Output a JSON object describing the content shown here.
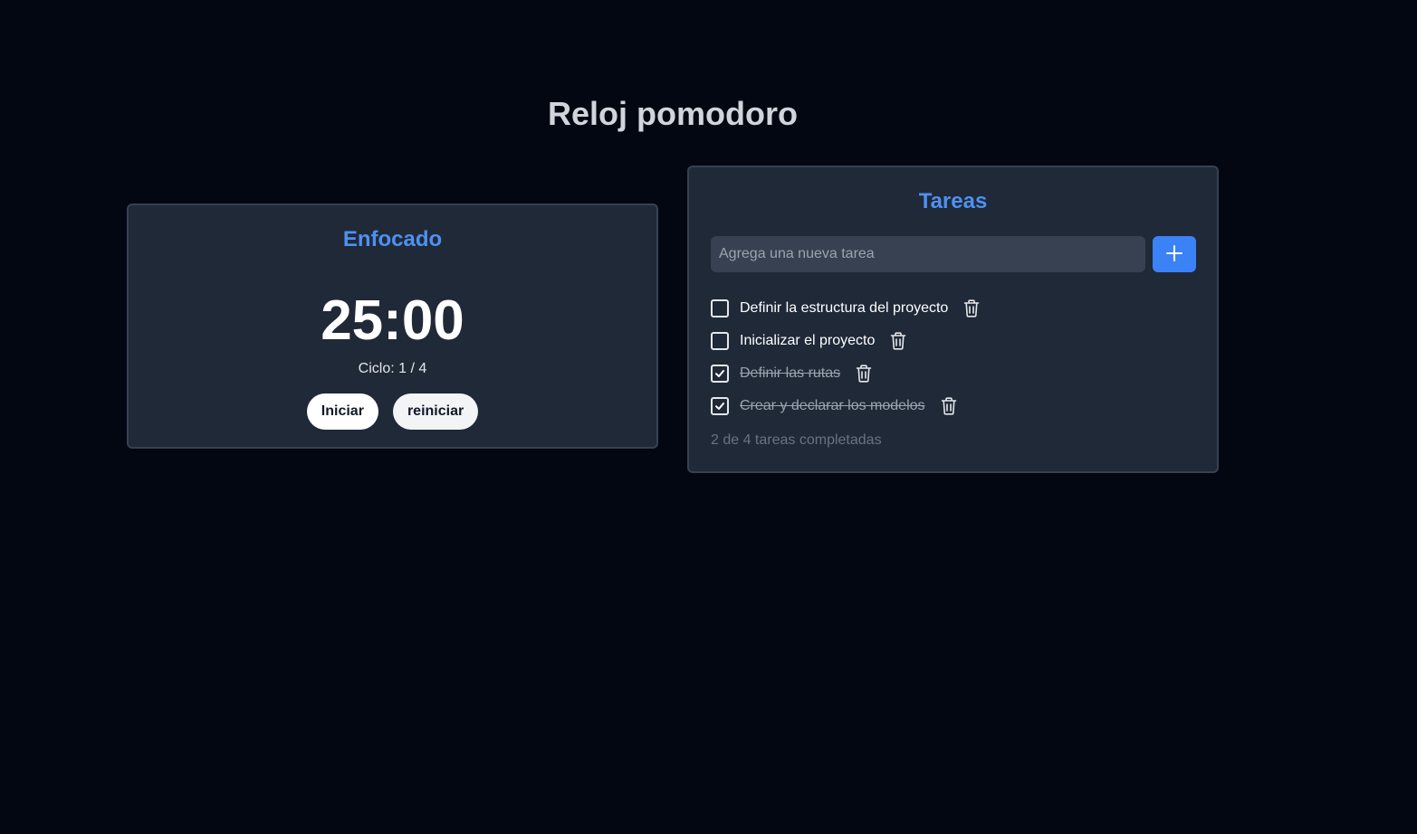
{
  "page": {
    "title": "Reloj pomodoro"
  },
  "timer": {
    "mode_label": "Enfocado",
    "time": "25:00",
    "cycle_label": "Ciclo:",
    "cycle_current": "1",
    "cycle_separator": "/",
    "cycle_total": "4",
    "start_label": "Iniciar",
    "reset_label": "reiniciar"
  },
  "tasks": {
    "heading": "Tareas",
    "input_placeholder": "Agrega una nueva tarea",
    "input_value": "",
    "add_icon": "plus-icon",
    "items": [
      {
        "label": "Definir la estructura del proyecto",
        "done": false
      },
      {
        "label": "Inicializar el proyecto",
        "done": false
      },
      {
        "label": "Definir las rutas",
        "done": true
      },
      {
        "label": "Crear y declarar los modelos",
        "done": true
      }
    ],
    "summary": "2 de 4 tareas completadas"
  },
  "colors": {
    "background": "#020712",
    "card": "#1f2937",
    "accent": "#3b82f6",
    "heading_accent": "#4f90f0"
  }
}
